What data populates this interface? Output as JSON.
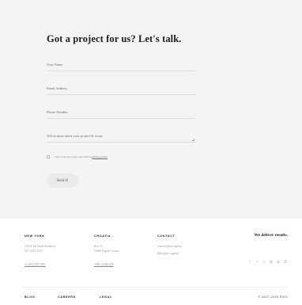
{
  "contact": {
    "title": "Got a project for us? Let's talk.",
    "fields": [
      {
        "label": "Your Name",
        "value": ""
      },
      {
        "label": "Email Address",
        "value": ""
      },
      {
        "label": "Phone Number",
        "value": ""
      },
      {
        "label": "Tell us more about your project & scope",
        "value": ""
      }
    ],
    "consent_text": "I have read and agree with PIVO's",
    "consent_link": "privacy policy",
    "send_label": "Send it!"
  },
  "footer": {
    "offices": [
      {
        "heading": "NEW YORK",
        "lines": [
          "136 W 4th Street Brooklyn",
          "NY 11201 USA"
        ],
        "phone": "+1 (212) 555 0151"
      },
      {
        "heading": "CROATIA",
        "lines": [
          "Ilica 31",
          "10000 Zagreb Croatia"
        ],
        "phone": "+385 1 2345 678"
      }
    ],
    "contact": {
      "heading": "CONTACT",
      "lines": [
        "contact@pivo.agency",
        "hello@pivo.agency"
      ]
    },
    "tagline": "We deliver results.",
    "social": [
      "facebook-icon",
      "twitter-icon",
      "instagram-icon",
      "linkedin-icon",
      "dribbble-icon",
      "behance-icon"
    ],
    "nav": [
      "BLOG",
      "CAREERS",
      "LEGAL"
    ],
    "copyright": "© 2007–2020 PIVO"
  }
}
